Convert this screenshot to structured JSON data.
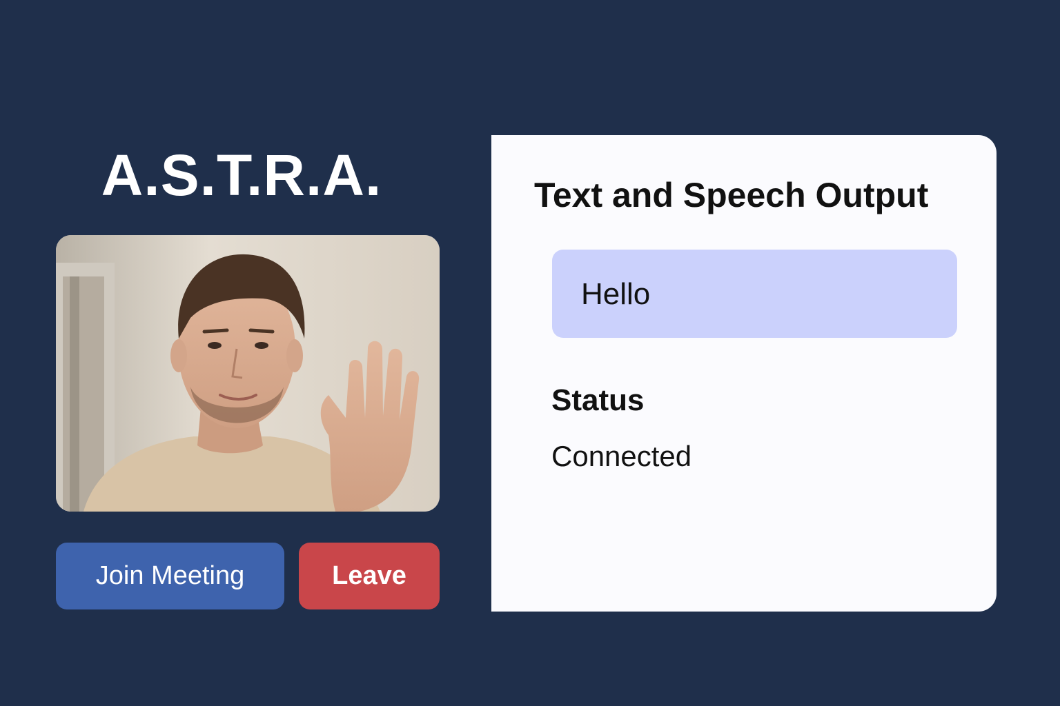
{
  "app": {
    "title": "A.S.T.R.A."
  },
  "video": {
    "description_icon": "person-waving-video-feed"
  },
  "controls": {
    "join_label": "Join Meeting",
    "leave_label": "Leave"
  },
  "output_panel": {
    "title": "Text and Speech Output",
    "speech_text": "Hello",
    "status_label": "Status",
    "status_value": "Connected"
  },
  "colors": {
    "background": "#1f2f4b",
    "join_button": "#3e63ad",
    "leave_button": "#c9464a",
    "panel": "#fbfbfe",
    "speech_box": "#cbd1fc"
  }
}
